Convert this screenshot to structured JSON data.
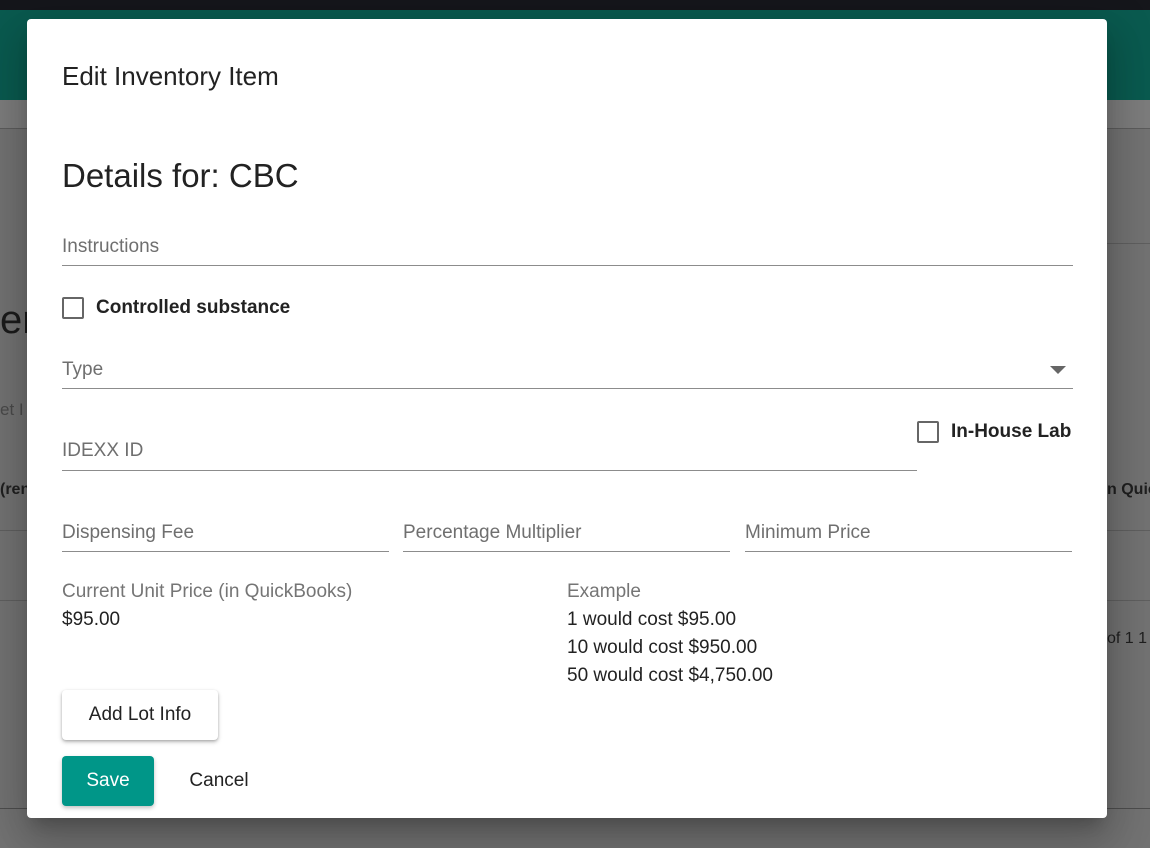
{
  "background": {
    "heading_fragment": "er",
    "label_fragment": "et I",
    "col_left_fragment": "(ren",
    "col_right_fragment": "n Quic",
    "pager_fragment": "1 of 1"
  },
  "dialog": {
    "title": "Edit Inventory Item",
    "details_heading": "Details for: CBC",
    "instructions_label": "Instructions",
    "controlled_substance_label": "Controlled substance",
    "type_label": "Type",
    "idexx_label": "IDEXX ID",
    "in_house_lab_label": "In-House Lab",
    "dispensing_fee_label": "Dispensing Fee",
    "percentage_multiplier_label": "Percentage Multiplier",
    "minimum_price_label": "Minimum Price",
    "current_price_label": "Current Unit Price (in QuickBooks)",
    "current_price_value": "$95.00",
    "example_label": "Example",
    "example_lines": [
      "1 would cost $95.00",
      "10 would cost $950.00",
      "50 would cost $4,750.00"
    ],
    "add_lot_label": "Add Lot Info",
    "save_label": "Save",
    "cancel_label": "Cancel"
  },
  "colors": {
    "accent": "#009688",
    "app_bar": "#00796b"
  },
  "icons": {
    "type_dropdown": "arrow-drop-down-icon"
  }
}
